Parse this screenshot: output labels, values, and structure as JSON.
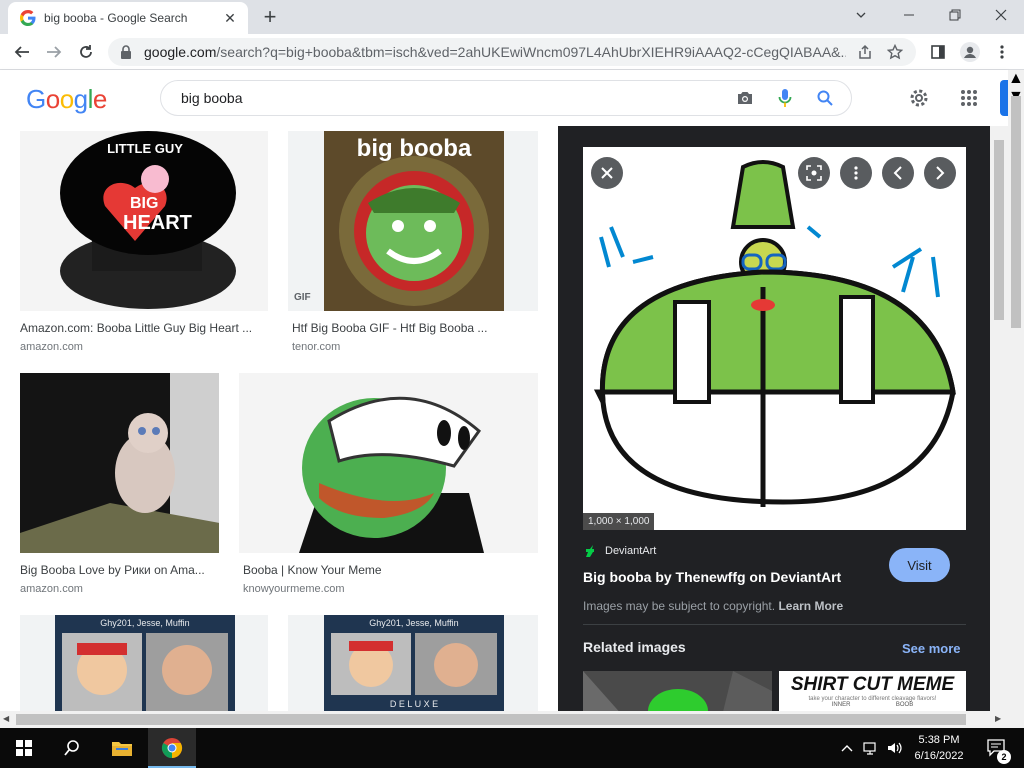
{
  "browser": {
    "tab_title": "big booba - Google Search",
    "url_host": "google.com",
    "url_rest": "/search?q=big+booba&tbm=isch&ved=2ahUKEwiWncm097L4AhUbrXIEHR9iAAAQ2-cCegQIABAA&...",
    "icons": [
      "back-icon",
      "forward-icon",
      "reload-icon",
      "lock-icon",
      "share-icon",
      "star-icon",
      "sidepanel-icon",
      "profile-icon",
      "menu-icon"
    ]
  },
  "google": {
    "logo_letters": [
      "G",
      "o",
      "o",
      "g",
      "l",
      "e"
    ],
    "query": "big booba"
  },
  "results": [
    {
      "caption": "Amazon.com: Booba Little Guy Big Heart ...",
      "source": "amazon.com",
      "overlay": ""
    },
    {
      "caption": "Htf Big Booba GIF - Htf Big Booba ...",
      "source": "tenor.com",
      "overlay": "big booba",
      "badge": "GIF"
    },
    {
      "caption": "Big Booba Love by Рики on Ama...",
      "source": "amazon.com",
      "overlay": ""
    },
    {
      "caption": "Booba | Know Your Meme",
      "source": "knowyourmeme.com",
      "overlay": ""
    },
    {
      "caption": "",
      "source": "",
      "overlay": "Ghy201, Jesse, Muffin"
    },
    {
      "caption": "",
      "source": "",
      "overlay": "Ghy201, Jesse, Muffin",
      "sub": "D E L U X E"
    }
  ],
  "panel": {
    "dimensions": "1,000 × 1,000",
    "site_name": "DeviantArt",
    "title": "Big booba by Thenewffg on DeviantArt",
    "visit_label": "Visit",
    "copyright": "Images may be subject to copyright.",
    "learn_more": "Learn More",
    "related_label": "Related images",
    "see_more": "See more",
    "related_2_text": "SHIRT CUT MEME",
    "related_2_sub": "take your character to different cleavage flavors!",
    "related_2_cols": [
      "INNER",
      "BOOB"
    ]
  },
  "taskbar": {
    "time": "5:38 PM",
    "date": "6/16/2022",
    "notification_count": "2"
  },
  "colors": {
    "google_blue": "#4285f4",
    "google_red": "#ea4335",
    "google_yellow": "#fbbc05",
    "google_green": "#34a853",
    "panel_bg": "#202124",
    "visit_bg": "#8ab4f8"
  }
}
